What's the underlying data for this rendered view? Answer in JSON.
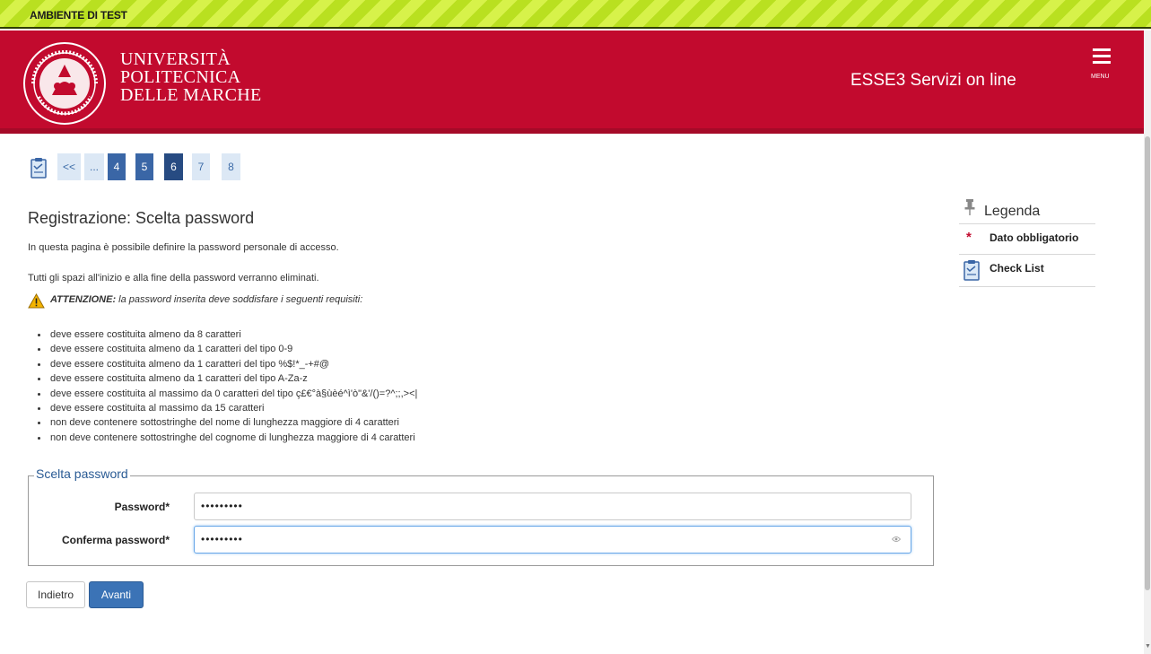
{
  "banner": {
    "text": "AMBIENTE DI TEST"
  },
  "header": {
    "university": [
      "UNIVERSITÀ",
      "POLITECNICA",
      "DELLE MARCHE"
    ],
    "service_title": "ESSE3 Servizi on line",
    "menu_label": "MENU",
    "seal_icon": "university-seal-icon"
  },
  "steps": {
    "items": [
      {
        "label": "<<",
        "state": "link"
      },
      {
        "label": "...",
        "state": "link"
      },
      {
        "label": "4",
        "state": "done"
      },
      {
        "label": "5",
        "state": "done"
      },
      {
        "label": "6",
        "state": "active"
      },
      {
        "label": "7",
        "state": "link"
      },
      {
        "label": "8",
        "state": "link"
      }
    ]
  },
  "main": {
    "title": "Registrazione: Scelta password",
    "intro": "In questa pagina è possibile definire la password personale di accesso.",
    "spaces_note": "Tutti gli spazi all'inizio e alla fine della password verranno eliminati.",
    "warning_prefix": "ATTENZIONE:",
    "warning_text": " la password inserita deve soddisfare i seguenti requisiti:",
    "rules": [
      "deve essere costituita almeno da 8 caratteri",
      "deve essere costituita almeno da 1 caratteri del tipo 0-9",
      "deve essere costituita almeno da 1 caratteri del tipo %$!*_-+#@",
      "deve essere costituita almeno da 1 caratteri del tipo A-Za-z",
      "deve essere costituita al massimo da 0 caratteri del tipo ç£€°à§ùèé^ì'ò\"&'/()=?^;;,><|",
      "deve essere costituita al massimo da 15 caratteri",
      "non deve contenere sottostringhe del nome di lunghezza maggiore di 4 caratteri",
      "non deve contenere sottostringhe del cognome di lunghezza maggiore di 4 caratteri"
    ]
  },
  "form": {
    "legend": "Scelta password",
    "password_label": "Password*",
    "password_value": "•••••••••",
    "confirm_label": "Conferma password*",
    "confirm_value": "•••••••••"
  },
  "buttons": {
    "back": "Indietro",
    "next": "Avanti"
  },
  "sidebar": {
    "title": "Legenda",
    "required_label": "Dato obbligatorio",
    "checklist_label": "Check List"
  },
  "colors": {
    "header_red": "#c20a2e",
    "step_active": "#274b82",
    "step_done": "#3a66a6",
    "primary_button": "#3b73b6"
  }
}
